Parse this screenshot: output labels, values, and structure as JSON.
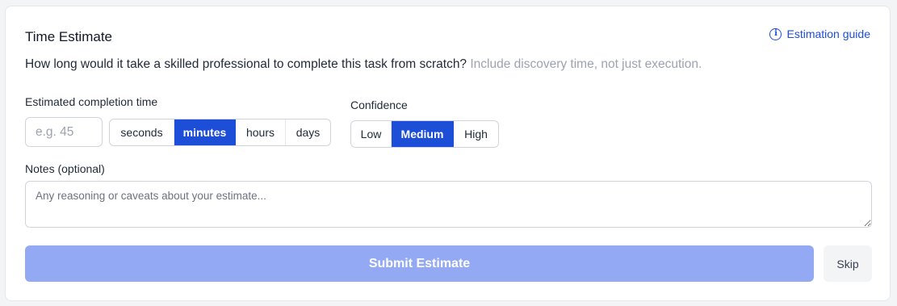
{
  "card": {
    "title": "Time Estimate",
    "guide_link": "Estimation guide",
    "question": "How long would it take a skilled professional to complete this task from scratch?",
    "question_hint": "Include discovery time, not just execution."
  },
  "completion": {
    "label": "Estimated completion time",
    "input_placeholder": "e.g. 45",
    "input_value": "",
    "units": [
      "seconds",
      "minutes",
      "hours",
      "days"
    ],
    "selected_unit": "minutes"
  },
  "confidence": {
    "label": "Confidence",
    "options": [
      "Low",
      "Medium",
      "High"
    ],
    "selected": "Medium"
  },
  "notes": {
    "label": "Notes (optional)",
    "placeholder": "Any reasoning or caveats about your estimate...",
    "value": ""
  },
  "actions": {
    "submit_label": "Submit Estimate",
    "skip_label": "Skip"
  },
  "colors": {
    "accent": "#1d4ed8",
    "submit_disabled": "#93a9f3",
    "hint_text": "#9ca3af"
  },
  "icons": {
    "guide": "info-icon"
  }
}
